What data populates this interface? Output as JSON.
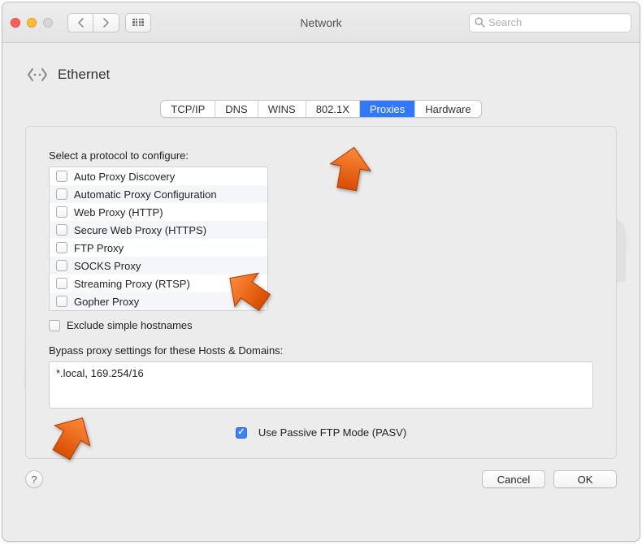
{
  "window": {
    "title": "Network",
    "search_placeholder": "Search"
  },
  "page": {
    "title": "Ethernet"
  },
  "tabs": [
    {
      "label": "TCP/IP",
      "active": false
    },
    {
      "label": "DNS",
      "active": false
    },
    {
      "label": "WINS",
      "active": false
    },
    {
      "label": "802.1X",
      "active": false
    },
    {
      "label": "Proxies",
      "active": true
    },
    {
      "label": "Hardware",
      "active": false
    }
  ],
  "protocols": {
    "label": "Select a protocol to configure:",
    "items": [
      {
        "label": "Auto Proxy Discovery",
        "checked": false
      },
      {
        "label": "Automatic Proxy Configuration",
        "checked": false
      },
      {
        "label": "Web Proxy (HTTP)",
        "checked": false
      },
      {
        "label": "Secure Web Proxy (HTTPS)",
        "checked": false
      },
      {
        "label": "FTP Proxy",
        "checked": false
      },
      {
        "label": "SOCKS Proxy",
        "checked": false
      },
      {
        "label": "Streaming Proxy (RTSP)",
        "checked": false
      },
      {
        "label": "Gopher Proxy",
        "checked": false
      }
    ]
  },
  "exclude": {
    "label": "Exclude simple hostnames",
    "checked": false
  },
  "bypass": {
    "label": "Bypass proxy settings for these Hosts & Domains:",
    "value": "*.local, 169.254/16"
  },
  "pasv": {
    "label": "Use Passive FTP Mode (PASV)",
    "checked": true
  },
  "buttons": {
    "help": "?",
    "cancel": "Cancel",
    "ok": "OK"
  },
  "watermark": "PCrisk.com"
}
